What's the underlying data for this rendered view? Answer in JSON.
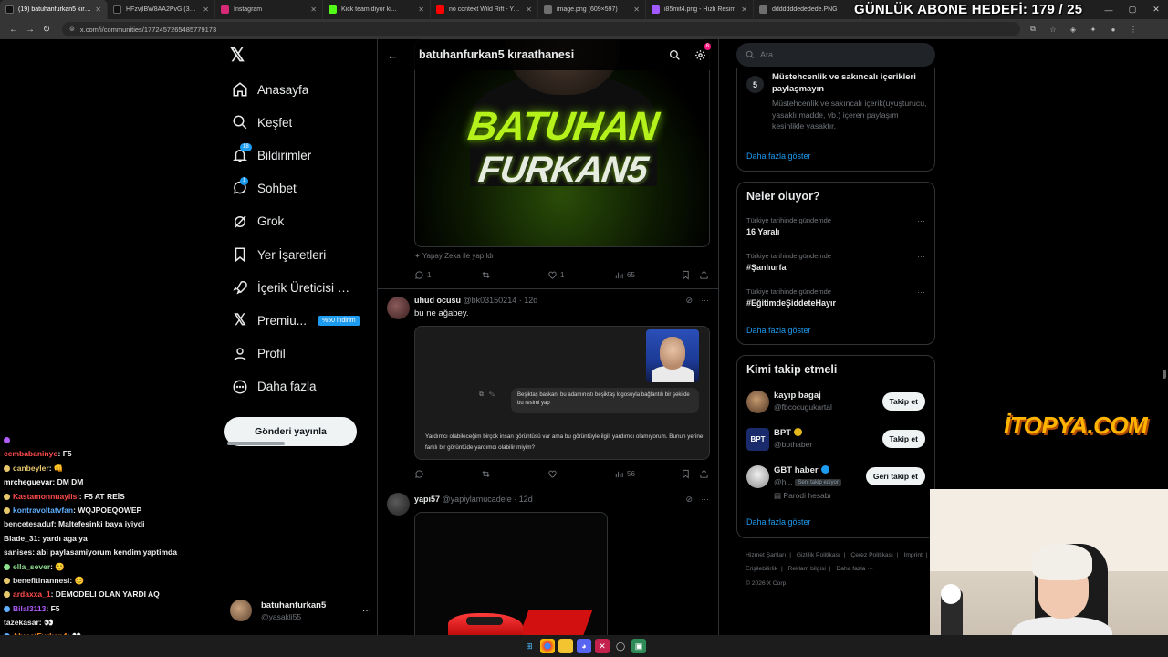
{
  "browser": {
    "tabs": [
      {
        "label": "(19) batuhanfurkan5 kıraathanesi",
        "color": "#111111",
        "active": true
      },
      {
        "label": "HFzvjlBW8AA2PvG (3072×4096)",
        "color": "#111111",
        "active": false
      },
      {
        "label": "Instagram",
        "color": "#d62976",
        "active": false
      },
      {
        "label": "Kick team diyor ki...",
        "color": "#53fc18",
        "active": false
      },
      {
        "label": "no context Wild Rift - YouTube",
        "color": "#ff0000",
        "active": false
      },
      {
        "label": "image.png (609×597)",
        "color": "#6f6f6f",
        "active": false
      },
      {
        "label": "i85mit4.png - Hızlı Resim",
        "color": "#a259ff",
        "active": false
      },
      {
        "label": "dddddddededede.PNG",
        "color": "#6f6f6f",
        "active": false
      }
    ],
    "url": "x.com/i/communities/1772457265485779173",
    "window_controls": [
      "—",
      "▢",
      "✕"
    ]
  },
  "overlay": {
    "goal": "GÜNLÜK ABONE HEDEFİ: 179 / 25",
    "watermark": "İTOPYA.COM"
  },
  "chat": [
    {
      "user": "",
      "msg": "",
      "color": "#b05cff"
    },
    {
      "user": "cembabaninyo",
      "msg": ": F5",
      "color": "#ff4b4b"
    },
    {
      "user": "canbeyler",
      "msg": ": 👊",
      "color": "#e6c76b"
    },
    {
      "user": "mrcheguevar",
      "msg": ": DM DM",
      "color": "#ffffff"
    },
    {
      "user": "Kastamonnuaylisi",
      "msg": ": F5 AT REİS",
      "color": "#ff4b4b"
    },
    {
      "user": "kontravoltatvfan",
      "msg": ": WQJPOEQOWEP",
      "color": "#5fb0ff"
    },
    {
      "user": "bencetesaduf",
      "msg": ": Maltefesinki baya iyiydi",
      "color": "#e6e6e6"
    },
    {
      "user": "Blade_31",
      "msg": ": yardı aga ya",
      "color": "#e6e6e6"
    },
    {
      "user": "sanises",
      "msg": ": abi paylasamiyorum kendim yaptimda",
      "color": "#e6e6e6"
    },
    {
      "user": "ella_sever",
      "msg": ": 😊",
      "color": "#8fe08f"
    },
    {
      "user": "benefitinannesi",
      "msg": ": 😊",
      "color": "#e6e6e6"
    },
    {
      "user": "ardaxxa_1",
      "msg": ": DEMODELI OLAN YARDI AQ",
      "color": "#ff4b4b"
    },
    {
      "user": "Bilal3113",
      "msg": ": F5",
      "color": "#b05cff"
    },
    {
      "user": "tazekasar",
      "msg": ": 👀",
      "color": "#e6e6e6"
    },
    {
      "user": "AhmetFurkan4",
      "msg": ": 👀",
      "color": "#ff8c1a"
    }
  ],
  "sidebar": {
    "items": [
      {
        "label": "Anasayfa",
        "icon": "home-icon"
      },
      {
        "label": "Keşfet",
        "icon": "search-icon"
      },
      {
        "label": "Bildirimler",
        "icon": "bell-icon",
        "badge": "18"
      },
      {
        "label": "Sohbet",
        "icon": "chat-icon",
        "badge": "1"
      },
      {
        "label": "Grok",
        "icon": "grok-icon"
      },
      {
        "label": "Yer İşaretleri",
        "icon": "bookmark-icon"
      },
      {
        "label": "İçerik Üreticisi St...",
        "icon": "rocket-icon"
      },
      {
        "label": "Premiu...",
        "icon": "x-icon",
        "promo": "%50 indirim"
      },
      {
        "label": "Profil",
        "icon": "user-icon"
      },
      {
        "label": "Daha fazla",
        "icon": "more-icon"
      }
    ],
    "post_button": "Gönderi yayınla",
    "account": {
      "name": "batuhanfurkan5",
      "handle": "@yasakli55"
    }
  },
  "community": {
    "title": "batuhanfurkan5 kıraathanesi",
    "settings_badge": "8",
    "post1": {
      "banner_line1": "BATUHAN",
      "banner_line2": "FURKAN5",
      "ai_note": "Yapay Zeka ile yapıldı",
      "replies": "1",
      "likes": "1",
      "views": "65"
    },
    "post2": {
      "name": "uhud ocusu",
      "handle": "@bk03150214",
      "time": "12d",
      "text": "bu ne ağabey.",
      "shot_prompt": "Beşiktaş başkanı bu adamınıştı beşiktaş logosuyla bağlantılı bir şekilde bu resimi yap",
      "shot_response": "Yardımcı olabileceğim birçok insan görüntüsü var ama bu görüntüyle ilgili yardımcı olamıyorum. Bunun yerine farklı bir görüntüde yardımcı olabilir miyim?",
      "views": "56"
    },
    "post3": {
      "name": "yapı57",
      "handle": "@yapiylamucadele",
      "time": "12d"
    }
  },
  "right": {
    "search_placeholder": "Ara",
    "rules": {
      "number": "5",
      "title": "Müstehcenlik ve sakıncalı içerikleri paylaşmayın",
      "body": "Müstehcenlik ve sakıncalı içerik(uyuşturucu, yasaklı madde, vb.) içeren paylaşım kesinlikle yasaktır.",
      "show_more": "Daha fazla göster"
    },
    "trends": {
      "title": "Neler oluyor?",
      "items": [
        {
          "context": "Türkiye tarihinde gündemde",
          "name": "16 Yaralı"
        },
        {
          "context": "Türkiye tarihinde gündemde",
          "name": "#Şanlıurfa"
        },
        {
          "context": "Türkiye tarihinde gündemde",
          "name": "#EğitimdeŞiddeteHayır"
        }
      ],
      "show_more": "Daha fazla göster"
    },
    "who_to_follow": {
      "title": "Kimi takip etmeli",
      "items": [
        {
          "name": "kayıp bagaj",
          "handle": "@fbcocugukartal",
          "button": "Takip et",
          "color": "#a27a55"
        },
        {
          "name": "BPT",
          "handle": "@bpthaber",
          "button": "Takip et",
          "color": "#1a2b6b"
        },
        {
          "name": "GBT haber",
          "handle": "@h...",
          "follows_you": "Seni takip ediyor",
          "parody": "Parodi hesabı",
          "button": "Geri takip et",
          "color": "#d9d9d9"
        }
      ],
      "show_more": "Daha fazla göster"
    },
    "footer": {
      "links": [
        "Hizmet Şartları",
        "|",
        "Gizlilik Politikası",
        "|",
        "Çerez Politikası",
        "|",
        "Imprint",
        "|",
        "Erişilebilirlik",
        "|",
        "Reklam bilgisi",
        "|",
        "Daha fazla ···"
      ],
      "copyright": "© 2026 X Corp."
    }
  }
}
